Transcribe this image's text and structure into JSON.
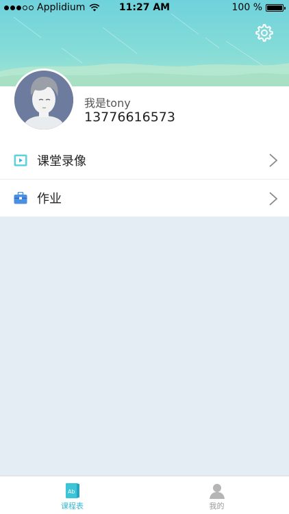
{
  "status_bar": {
    "carrier": "Applidium",
    "time": "11:27 AM",
    "battery": "100 %"
  },
  "profile": {
    "username": "我是tony",
    "phone": "13776616573"
  },
  "menu": {
    "items": [
      {
        "label": "课堂录像",
        "icon": "video-icon"
      },
      {
        "label": "作业",
        "icon": "briefcase-icon"
      }
    ]
  },
  "tabbar": {
    "tabs": [
      {
        "label": "课程表",
        "icon": "book-icon",
        "active": true
      },
      {
        "label": "我的",
        "icon": "person-icon",
        "active": false
      }
    ]
  },
  "colors": {
    "accent": "#37b8d6",
    "header_top": "#6fd2dc",
    "background": "#e3edf3"
  }
}
